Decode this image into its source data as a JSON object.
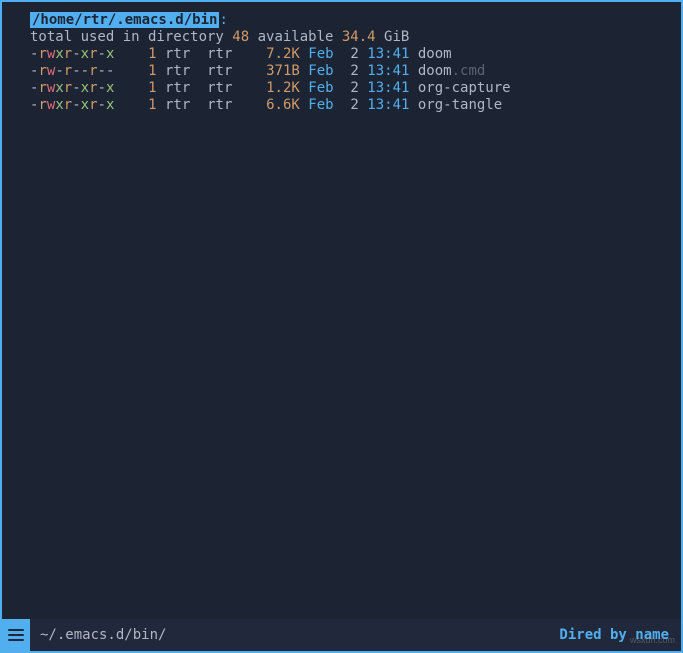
{
  "header": {
    "path": "/home/rtr/.emacs.d/bin",
    "colon": ":"
  },
  "summary": {
    "prefix": "total used in directory ",
    "blocks": "48",
    "mid": " available ",
    "avail": "34.4",
    "unit": " GiB"
  },
  "rows": [
    {
      "perm_chars": [
        "-",
        "r",
        "w",
        "x",
        "r",
        "-",
        "x",
        "r",
        "-",
        "x"
      ],
      "perm_classes": [
        "perm-dash",
        "perm-r",
        "perm-w",
        "perm-x",
        "perm-r",
        "perm-dash",
        "perm-x",
        "perm-r",
        "perm-dash",
        "perm-x"
      ],
      "links": "1",
      "user": "rtr",
      "group": "rtr",
      "size": "7.2K",
      "month": "Feb",
      "day": "2",
      "time": "13:41",
      "name": "doom",
      "ext": ""
    },
    {
      "perm_chars": [
        "-",
        "r",
        "w",
        "-",
        "r",
        "-",
        "-",
        "r",
        "-",
        "-"
      ],
      "perm_classes": [
        "perm-dash",
        "perm-r",
        "perm-w",
        "perm-dash",
        "perm-r",
        "perm-dash",
        "perm-dash",
        "perm-r",
        "perm-dash",
        "perm-dash"
      ],
      "links": "1",
      "user": "rtr",
      "group": "rtr",
      "size": "371B",
      "month": "Feb",
      "day": "2",
      "time": "13:41",
      "name": "doom",
      "ext": ".cmd"
    },
    {
      "perm_chars": [
        "-",
        "r",
        "w",
        "x",
        "r",
        "-",
        "x",
        "r",
        "-",
        "x"
      ],
      "perm_classes": [
        "perm-dash",
        "perm-r",
        "perm-w",
        "perm-x",
        "perm-r",
        "perm-dash",
        "perm-x",
        "perm-r",
        "perm-dash",
        "perm-x"
      ],
      "links": "1",
      "user": "rtr",
      "group": "rtr",
      "size": "1.2K",
      "month": "Feb",
      "day": "2",
      "time": "13:41",
      "name": "org-capture",
      "ext": ""
    },
    {
      "perm_chars": [
        "-",
        "r",
        "w",
        "x",
        "r",
        "-",
        "x",
        "r",
        "-",
        "x"
      ],
      "perm_classes": [
        "perm-dash",
        "perm-r",
        "perm-w",
        "perm-x",
        "perm-r",
        "perm-dash",
        "perm-x",
        "perm-r",
        "perm-dash",
        "perm-x"
      ],
      "links": "1",
      "user": "rtr",
      "group": "rtr",
      "size": "6.6K",
      "month": "Feb",
      "day": "2",
      "time": "13:41",
      "name": "org-tangle",
      "ext": ""
    }
  ],
  "modeline": {
    "path": "~/.emacs.d/bin/",
    "right": "Dired by name"
  },
  "watermark": "wsxdn.com"
}
